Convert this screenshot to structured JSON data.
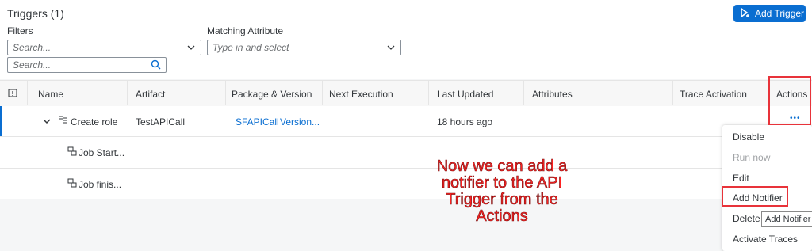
{
  "header": {
    "title": "Triggers (1)",
    "add_button_label": "Add Trigger"
  },
  "filters": {
    "filters_label": "Filters",
    "filters_placeholder": "Search...",
    "matching_label": "Matching Attribute",
    "matching_placeholder": "Type in and select",
    "search_placeholder": "Search..."
  },
  "table": {
    "columns": [
      "Name",
      "Artifact",
      "Package & Version",
      "Next Execution",
      "Last Updated",
      "Attributes",
      "Trace Activation",
      "Actions"
    ],
    "row": {
      "name": "Create role",
      "artifact": "TestAPICall",
      "package": "SFAPICall",
      "version": "Version...",
      "last_updated": "18 hours ago",
      "actions": "•••"
    },
    "subrows": [
      "Job Start...",
      "Job finis..."
    ]
  },
  "actions_menu": {
    "items": [
      {
        "label": "Disable",
        "enabled": true
      },
      {
        "label": "Run now",
        "enabled": false
      },
      {
        "label": "Edit",
        "enabled": true
      },
      {
        "label": "Add Notifier",
        "enabled": true
      },
      {
        "label": "Delete",
        "enabled": true
      },
      {
        "label": "Activate Traces",
        "enabled": true
      }
    ]
  },
  "tooltip": "Add Notifier",
  "annotation": "Now we can add a notifier to the API Trigger from the Actions",
  "colors": {
    "accent": "#0a6ed1",
    "annotation": "#ff2222"
  }
}
